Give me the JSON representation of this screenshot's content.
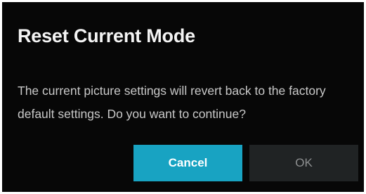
{
  "dialog": {
    "title": "Reset Current Mode",
    "message": "The current picture settings will revert back to the factory default settings. Do you want to continue?",
    "buttons": {
      "cancel_label": "Cancel",
      "ok_label": "OK",
      "focused": "Cancel"
    },
    "colors": {
      "background": "#070707",
      "focused_button": "#18a3c2",
      "unfocused_button": "#202324",
      "title_text": "#f4f4f4",
      "body_text": "#c9c9c9"
    }
  }
}
